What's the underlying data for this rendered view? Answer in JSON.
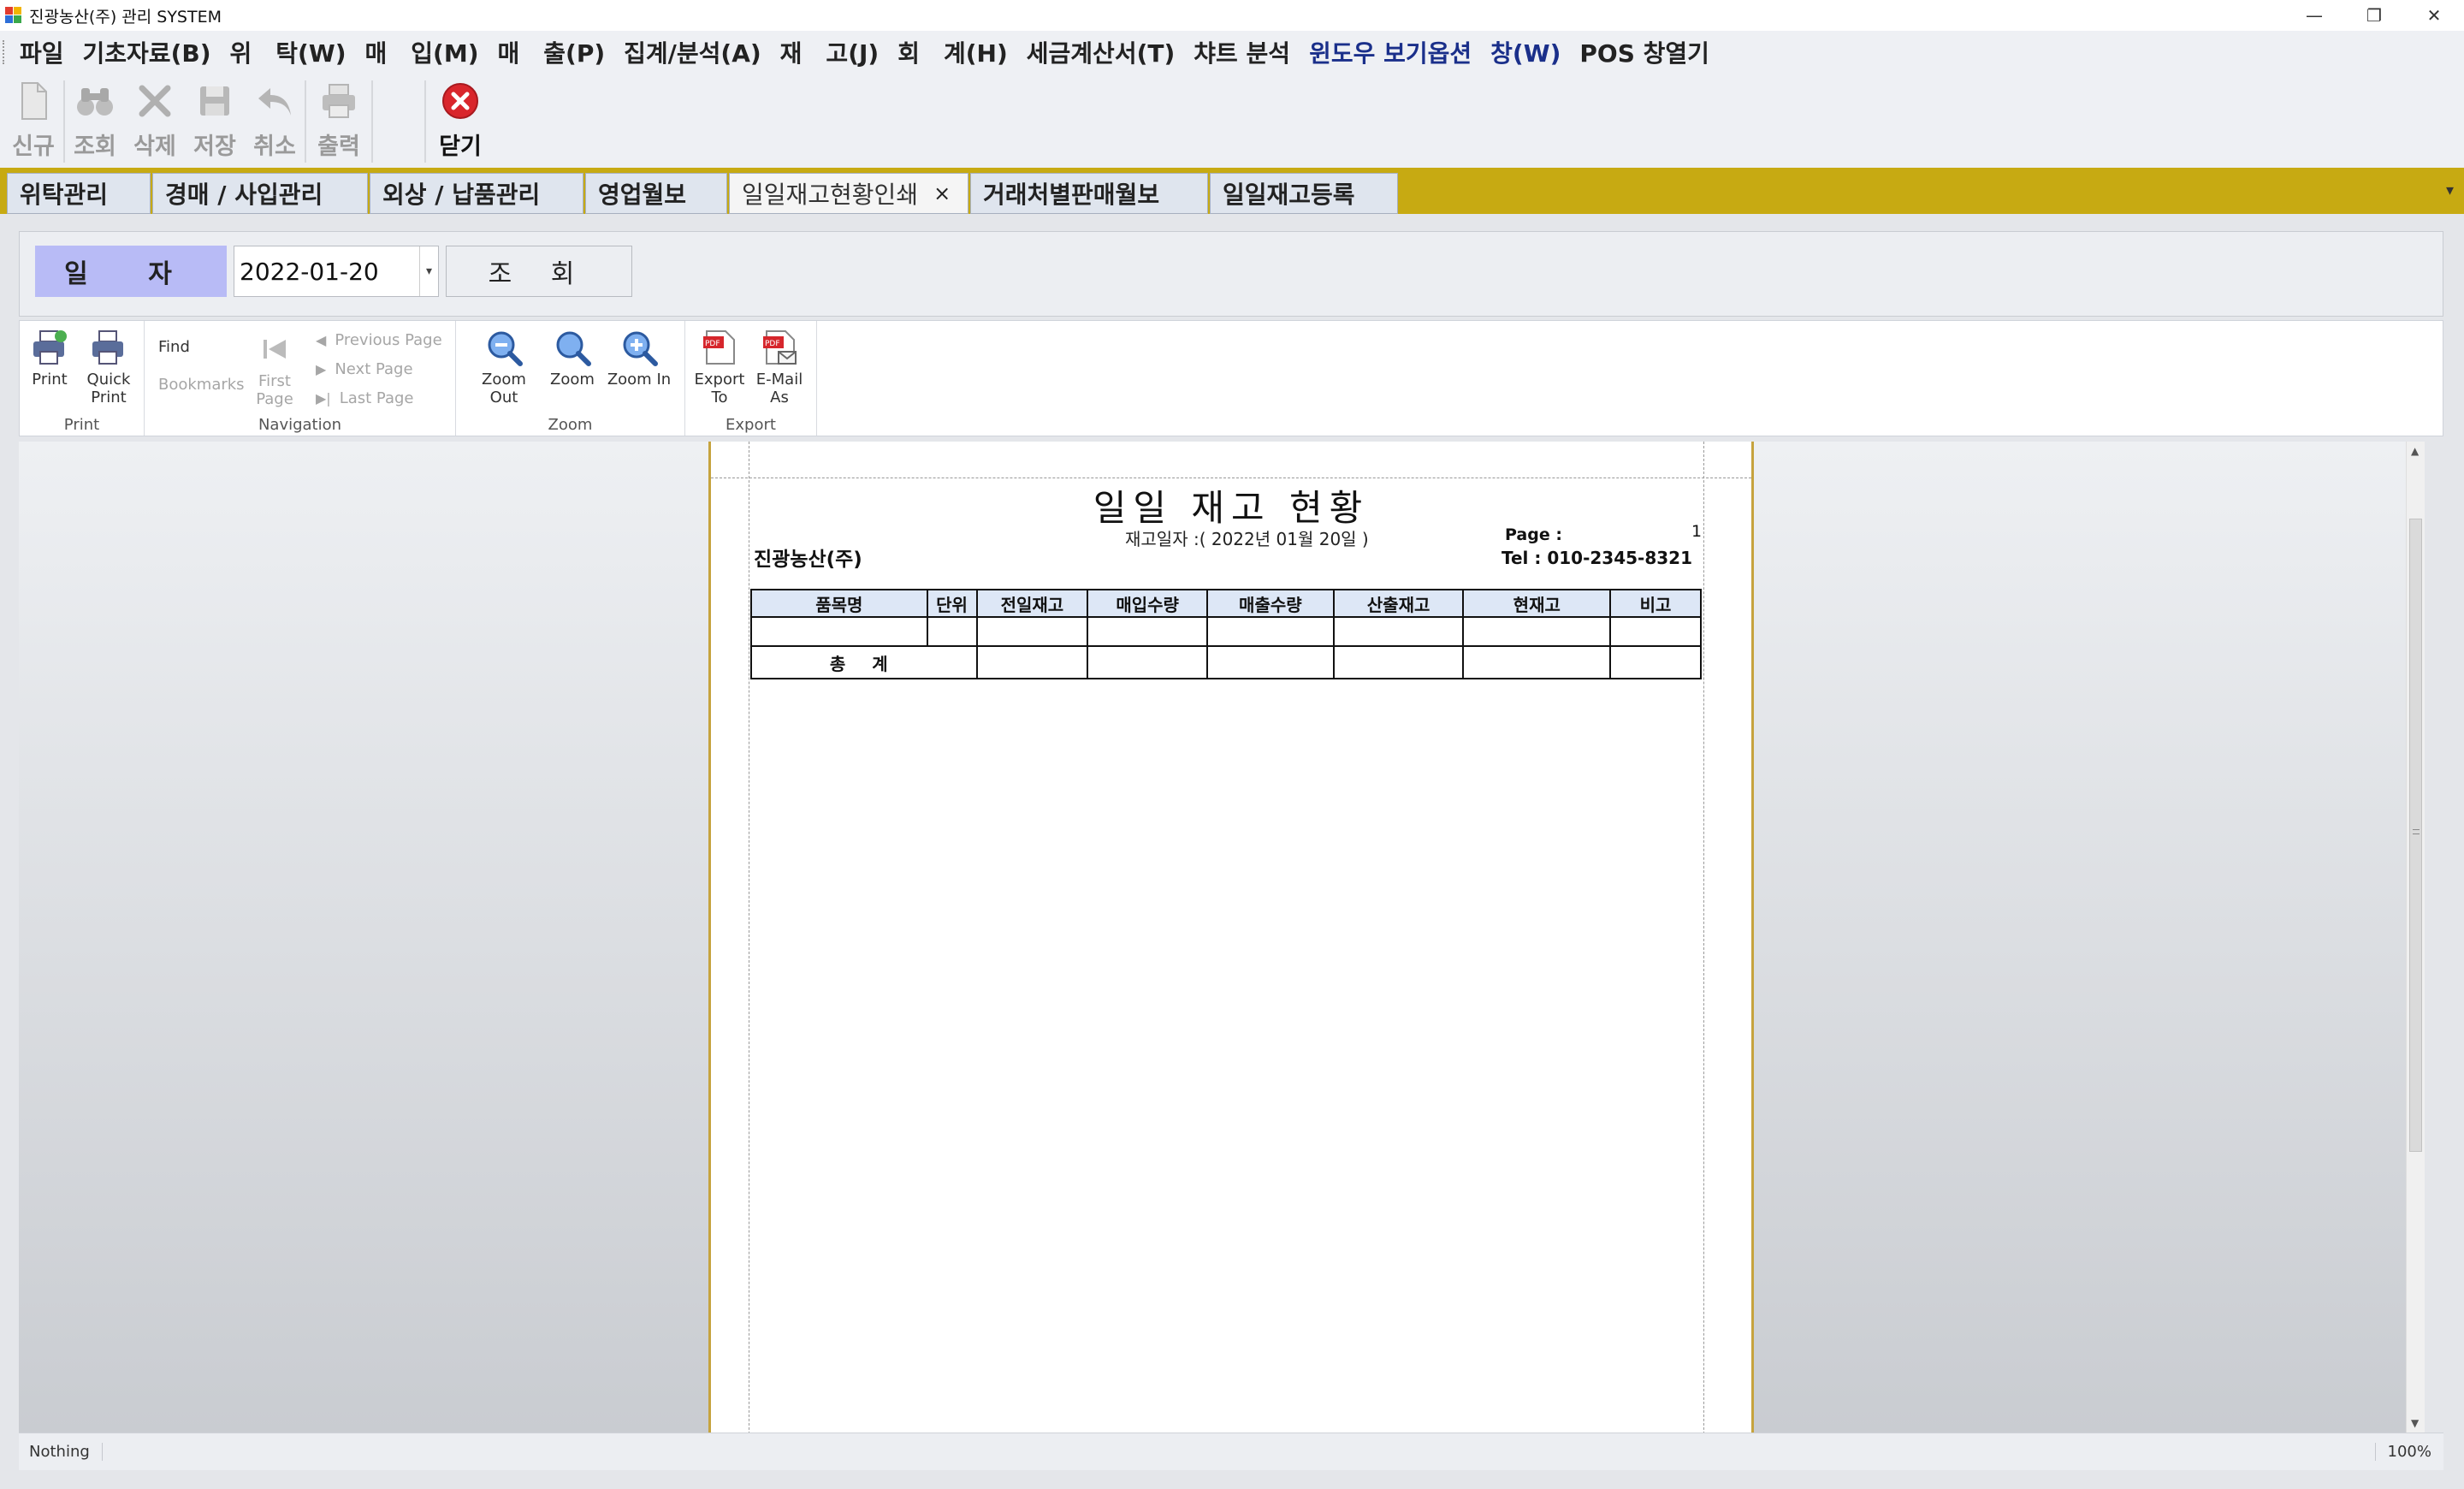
{
  "window": {
    "title": "진광농산(주) 관리 SYSTEM",
    "controls": [
      "—",
      "❐",
      "✕"
    ]
  },
  "menu": [
    "파일",
    "기초자료(B)",
    "위　탁(W)",
    "매　입(M)",
    "매　출(P)",
    "집계/분석(A)",
    "재　고(J)",
    "회　계(H)",
    "세금계산서(T)",
    "챠트 분석",
    "윈도우 보기옵션",
    "창(W)",
    "POS 창열기"
  ],
  "toolbar": {
    "new": "신규",
    "search": "조회",
    "delete": "삭제",
    "save": "저장",
    "cancel": "취소",
    "print": "출력",
    "close": "닫기"
  },
  "tabs": [
    {
      "label": "위탁관리"
    },
    {
      "label": "경매 / 사입관리"
    },
    {
      "label": "외상 / 납품관리"
    },
    {
      "label": "영업월보"
    },
    {
      "label": "일일재고현황인쇄",
      "close": "×"
    },
    {
      "label": "거래처별판매월보"
    },
    {
      "label": "일일재고등록"
    }
  ],
  "filter": {
    "date_label": "일 자",
    "date_value": "2022-01-20",
    "query_button": "조 회"
  },
  "ribbon": {
    "print_group": "Print",
    "print": "Print",
    "quick_print": "Quick Print",
    "navigation_group": "Navigation",
    "find": "Find",
    "bookmarks": "Bookmarks",
    "first_page": "First Page",
    "previous_page": "Previous Page",
    "next_page": "Next Page",
    "last_page": "Last Page",
    "zoom_group": "Zoom",
    "zoom_out": "Zoom Out",
    "zoom": "Zoom",
    "zoom_in": "Zoom In",
    "export_group": "Export",
    "export_to": "Export To",
    "email_as": "E-Mail As"
  },
  "report": {
    "title": "일일 재고 현황",
    "date_caption": "재고일자 :( 2022년 01월 20일 )",
    "company": "진광농산(주)",
    "page_label": "Page :",
    "page_number": "1",
    "tel": "Tel :   010-2345-8321",
    "columns": [
      "품목명",
      "단위",
      "전일재고",
      "매입수량",
      "매출수량",
      "산출재고",
      "현재고",
      "비고"
    ],
    "total_label": "총 계"
  },
  "status": {
    "left": "Nothing",
    "zoom": "100%"
  }
}
